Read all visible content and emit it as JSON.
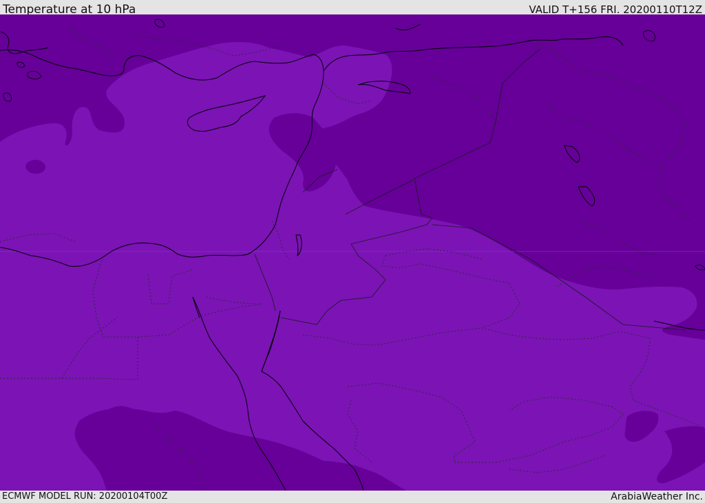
{
  "header": {
    "title": "Temperature at 10 hPa",
    "valid": "VALID T+156 FRI. 20200110T12Z"
  },
  "footer": {
    "model_run": "ECMWF MODEL RUN: 20200104T00Z",
    "credit": "ArabiaWeather Inc."
  },
  "map": {
    "region": "Eastern Mediterranean and Middle East",
    "variable": "Temperature at 10 hPa",
    "colors": {
      "warmer_band": "#7b13b5",
      "colder_band": "#660099",
      "coastline": "#000000",
      "borders": "#222222",
      "grid": "#8a40c0"
    }
  }
}
